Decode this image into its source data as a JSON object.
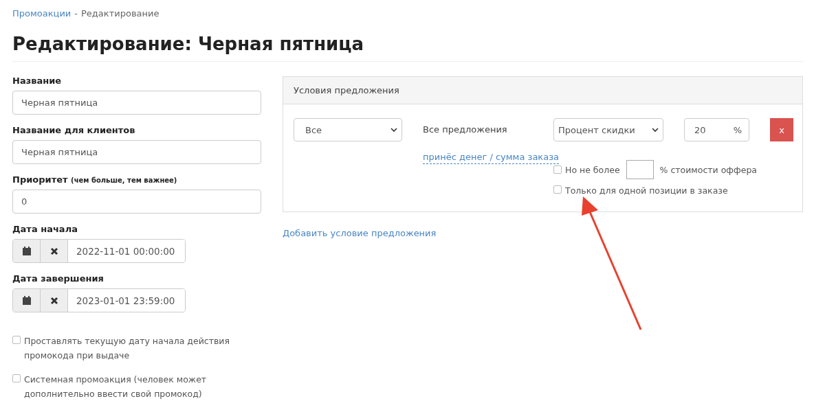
{
  "breadcrumb": {
    "link": "Промоакции",
    "separator": "-",
    "current": "Редактирование"
  },
  "title": "Редактирование: Черная пятница",
  "fields": [
    {
      "kind": "text",
      "label": "Название",
      "value": "Черная пятница"
    },
    {
      "kind": "text",
      "label": "Название для клиентов",
      "value": "Черная пятница"
    },
    {
      "kind": "text",
      "label": "Приоритет",
      "hint": "(чем больше, тем важнее)",
      "value": "0"
    },
    {
      "kind": "date",
      "label": "Дата начала",
      "value": "2022-11-01 00:00:00"
    },
    {
      "kind": "date",
      "label": "Дата завершения",
      "value": "2023-01-01 23:59:00"
    }
  ],
  "options": [
    {
      "label": "Проставлять текущую дату начала действия промокода при выдаче",
      "checked": false
    },
    {
      "label": "Системная промоакция (человек может дополнительно ввести свой промокод)",
      "checked": false
    }
  ],
  "conditions": {
    "title": "Условия предложения",
    "scope_select": "Все",
    "scope_text": "Все предложения",
    "type_link": "принёс денег / сумма заказа",
    "discount_select": "Процент скидки",
    "amount": "20",
    "unit": "%",
    "remove_button": "x",
    "limit": {
      "checked": false,
      "prefix": "Но не более",
      "suffix": "% стоимости оффера"
    },
    "single_position": {
      "checked": false,
      "label": "Только для одной позиции в заказе"
    }
  },
  "add_condition": "Добавить условие предложения",
  "annotation": {
    "kind": "arrow",
    "color": "#e8412e"
  }
}
